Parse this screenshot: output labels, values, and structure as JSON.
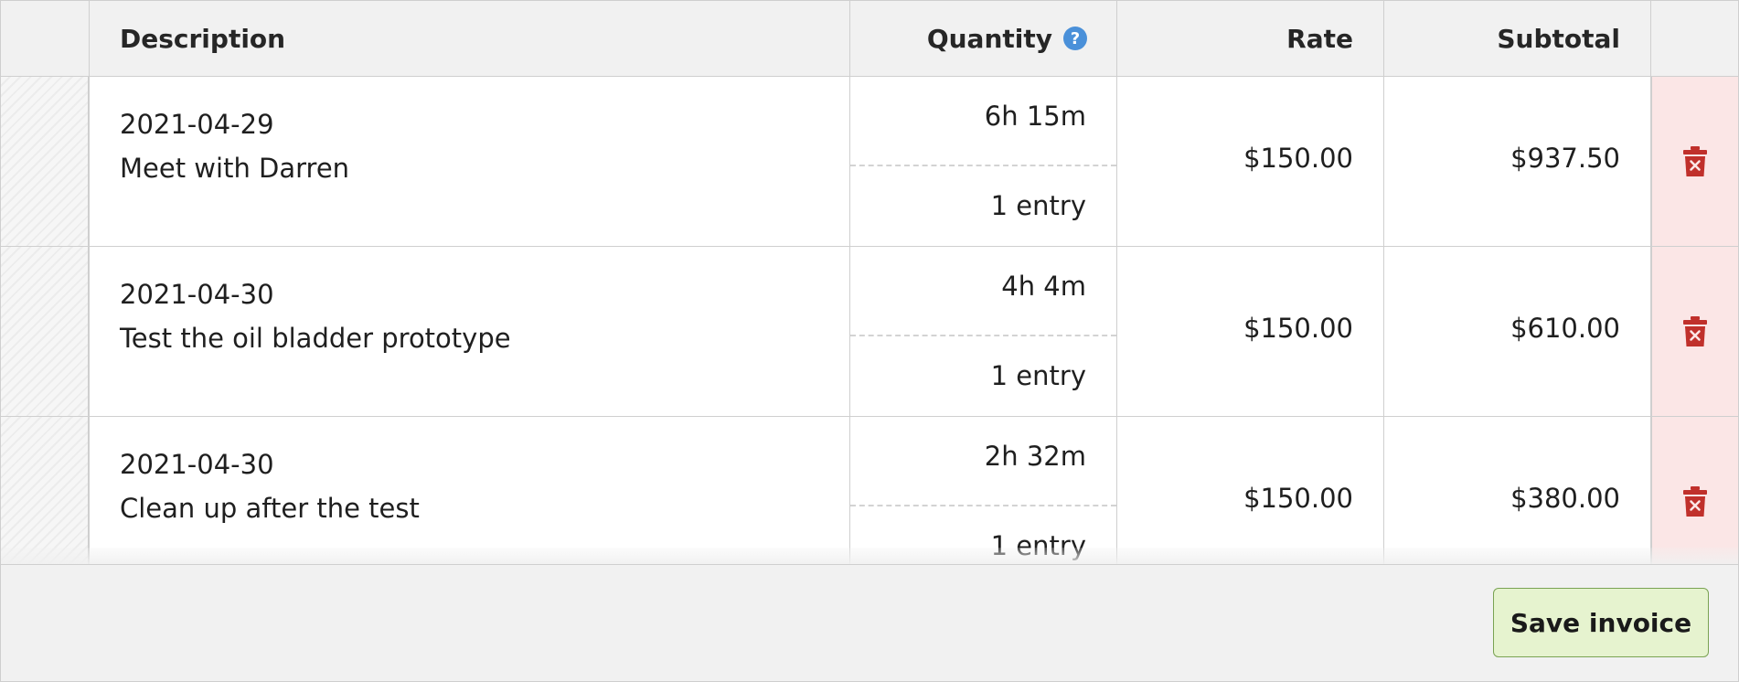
{
  "table": {
    "headers": {
      "description": "Description",
      "quantity": "Quantity",
      "quantity_help": "?",
      "rate": "Rate",
      "subtotal": "Subtotal"
    },
    "rows": [
      {
        "date": "2021-04-29",
        "description": "Meet with Darren",
        "quantity": "6h 15m",
        "entries": "1 entry",
        "rate": "$150.00",
        "subtotal": "$937.50"
      },
      {
        "date": "2021-04-30",
        "description": "Test the oil bladder prototype",
        "quantity": "4h 4m",
        "entries": "1 entry",
        "rate": "$150.00",
        "subtotal": "$610.00"
      },
      {
        "date": "2021-04-30",
        "description": "Clean up after the test",
        "quantity": "2h 32m",
        "entries": "1 entry",
        "rate": "$150.00",
        "subtotal": "$380.00"
      }
    ]
  },
  "footer": {
    "save_label": "Save invoice"
  },
  "colors": {
    "delete_bg": "#fbe6e6",
    "delete_icon": "#c0302b",
    "save_bg": "#e6f3cf",
    "help_icon": "#4a90d9"
  },
  "icons": {
    "delete": "trash-icon",
    "help": "help-icon"
  }
}
